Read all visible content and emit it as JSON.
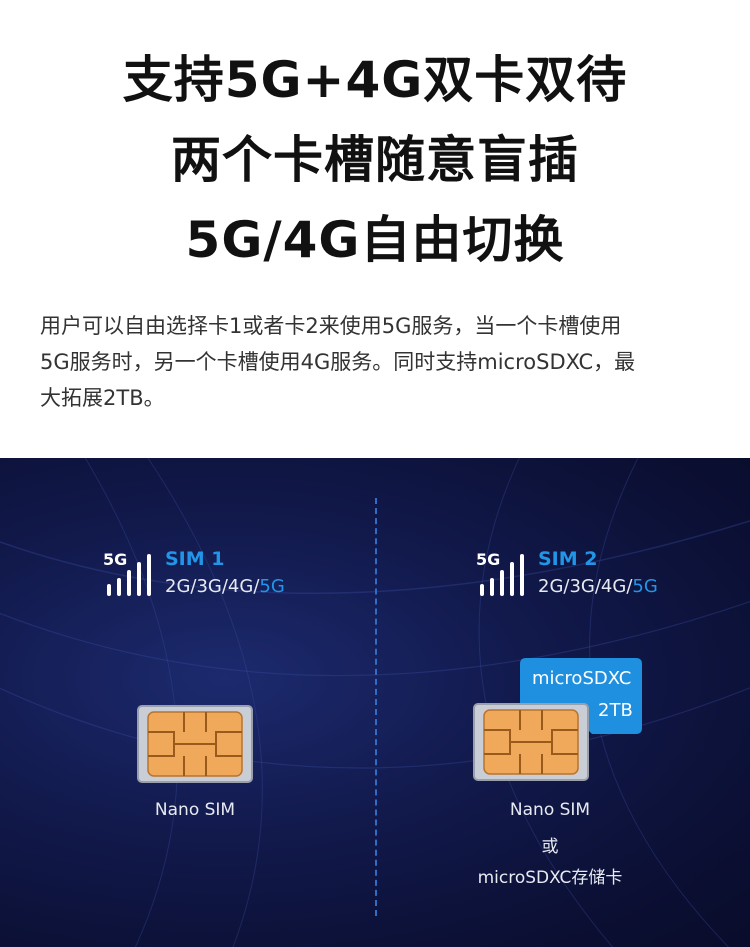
{
  "headline": {
    "line1": "支持5G+4G双卡双待",
    "line2": "两个卡槽随意盲插",
    "line3": "5G/4G自由切换"
  },
  "description": {
    "line1": "用户可以自由选择卡1或者卡2来使用5G服务，当一个卡槽使用",
    "line2": "5G服务时，另一个卡槽使用4G服务。同时支持microSDXC，最",
    "line3": "大拓展2TB。"
  },
  "slots": [
    {
      "signal_label": "5G",
      "sim_title": "SIM 1",
      "bands_prefix": "2G/3G/4G/",
      "bands_highlight": "5G",
      "caption": "Nano SIM"
    },
    {
      "signal_label": "5G",
      "sim_title": "SIM 2",
      "bands_prefix": "2G/3G/4G/",
      "bands_highlight": "5G",
      "caption_line1": "Nano SIM",
      "caption_line2": "或",
      "caption_line3": "microSDXC存储卡",
      "sd_card": {
        "name": "microSDXC",
        "capacity": "2TB"
      }
    }
  ],
  "colors": {
    "accent": "#2196e8",
    "background_dark": "#0b0f33",
    "sim_chip": "#f0a85a",
    "headline": "#111111"
  },
  "icons": [
    "signal-bars-icon",
    "sim-card-icon",
    "microsd-card-icon"
  ]
}
